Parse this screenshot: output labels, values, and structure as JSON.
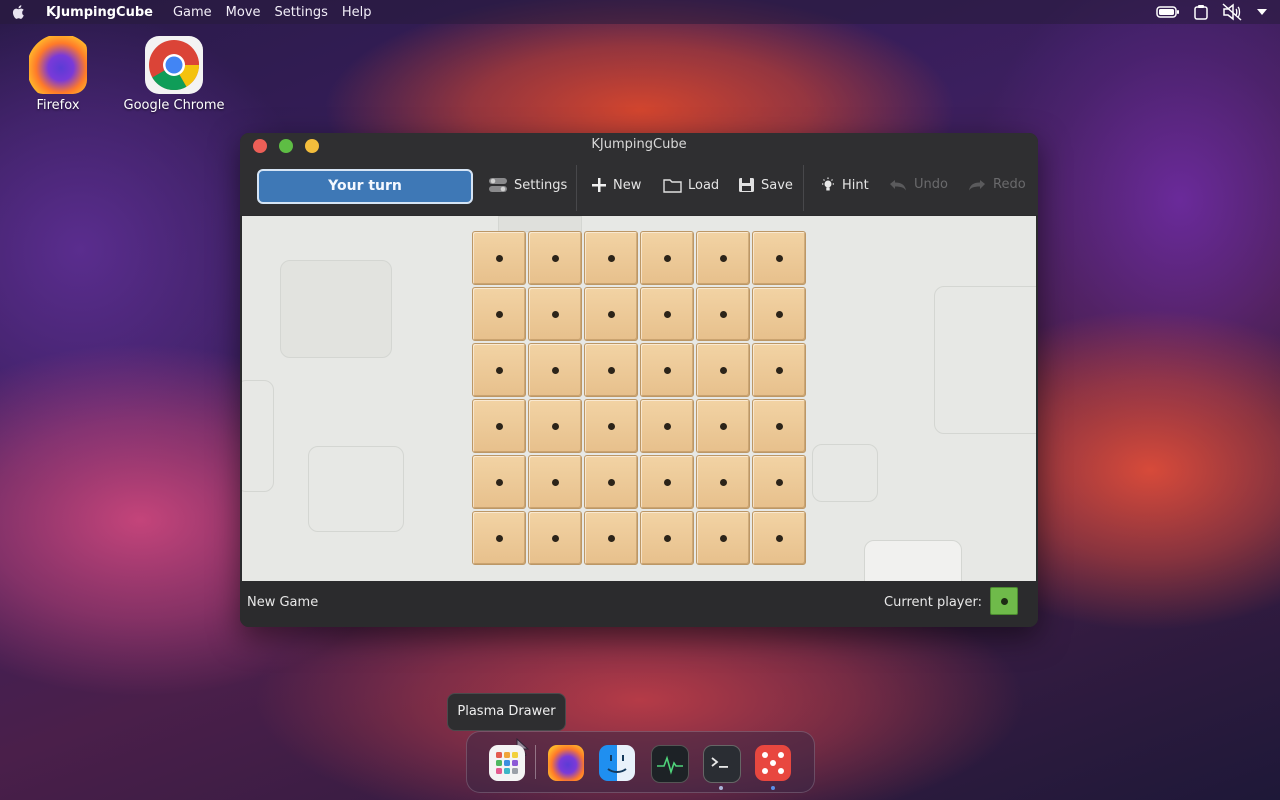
{
  "menubar": {
    "app_name": "KJumpingCube",
    "menus": [
      "Game",
      "Move",
      "Settings",
      "Help"
    ]
  },
  "desktop": {
    "icons": [
      {
        "label": "Firefox"
      },
      {
        "label": "Google Chrome"
      }
    ]
  },
  "window": {
    "title": "KJumpingCube",
    "toolbar": {
      "turn_label": "Your turn",
      "settings": "Settings",
      "new": "New",
      "load": "Load",
      "save": "Save",
      "hint": "Hint",
      "undo": "Undo",
      "redo": "Redo"
    },
    "board": {
      "rows": 6,
      "cols": 6,
      "cube_value": 1,
      "cube_color": "#e9c48f"
    },
    "status": {
      "left": "New Game",
      "current_player_label": "Current player:",
      "current_player_color": "#6fba4a"
    }
  },
  "tooltip": {
    "text": "Plasma Drawer"
  },
  "colors": {
    "accent": "#3e78b6"
  }
}
